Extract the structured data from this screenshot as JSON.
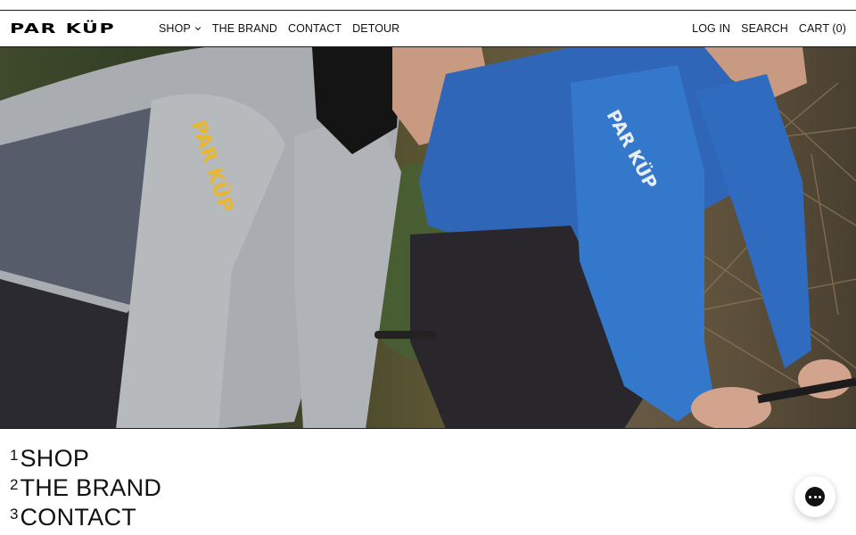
{
  "header": {
    "logo_text": "PAR KÜP",
    "nav_left": [
      {
        "label": "SHOP"
      },
      {
        "label": "THE BRAND"
      },
      {
        "label": "CONTACT"
      },
      {
        "label": "DETOUR"
      }
    ],
    "nav_right": [
      {
        "label": "LOG IN"
      },
      {
        "label": "SEARCH"
      },
      {
        "label": "CART (0)"
      }
    ]
  },
  "hero": {
    "jersey_left_text": "PAR KÜP",
    "jersey_right_text": "PAR KÜP",
    "jersey_left_color": "#a9acb0",
    "jersey_right_color": "#2f66b8"
  },
  "footer_menu": [
    {
      "num": "1",
      "label": "SHOP"
    },
    {
      "num": "2",
      "label": "THE BRAND"
    },
    {
      "num": "3",
      "label": "CONTACT"
    }
  ],
  "chat": {
    "icon": "chat-bubble-icon"
  }
}
